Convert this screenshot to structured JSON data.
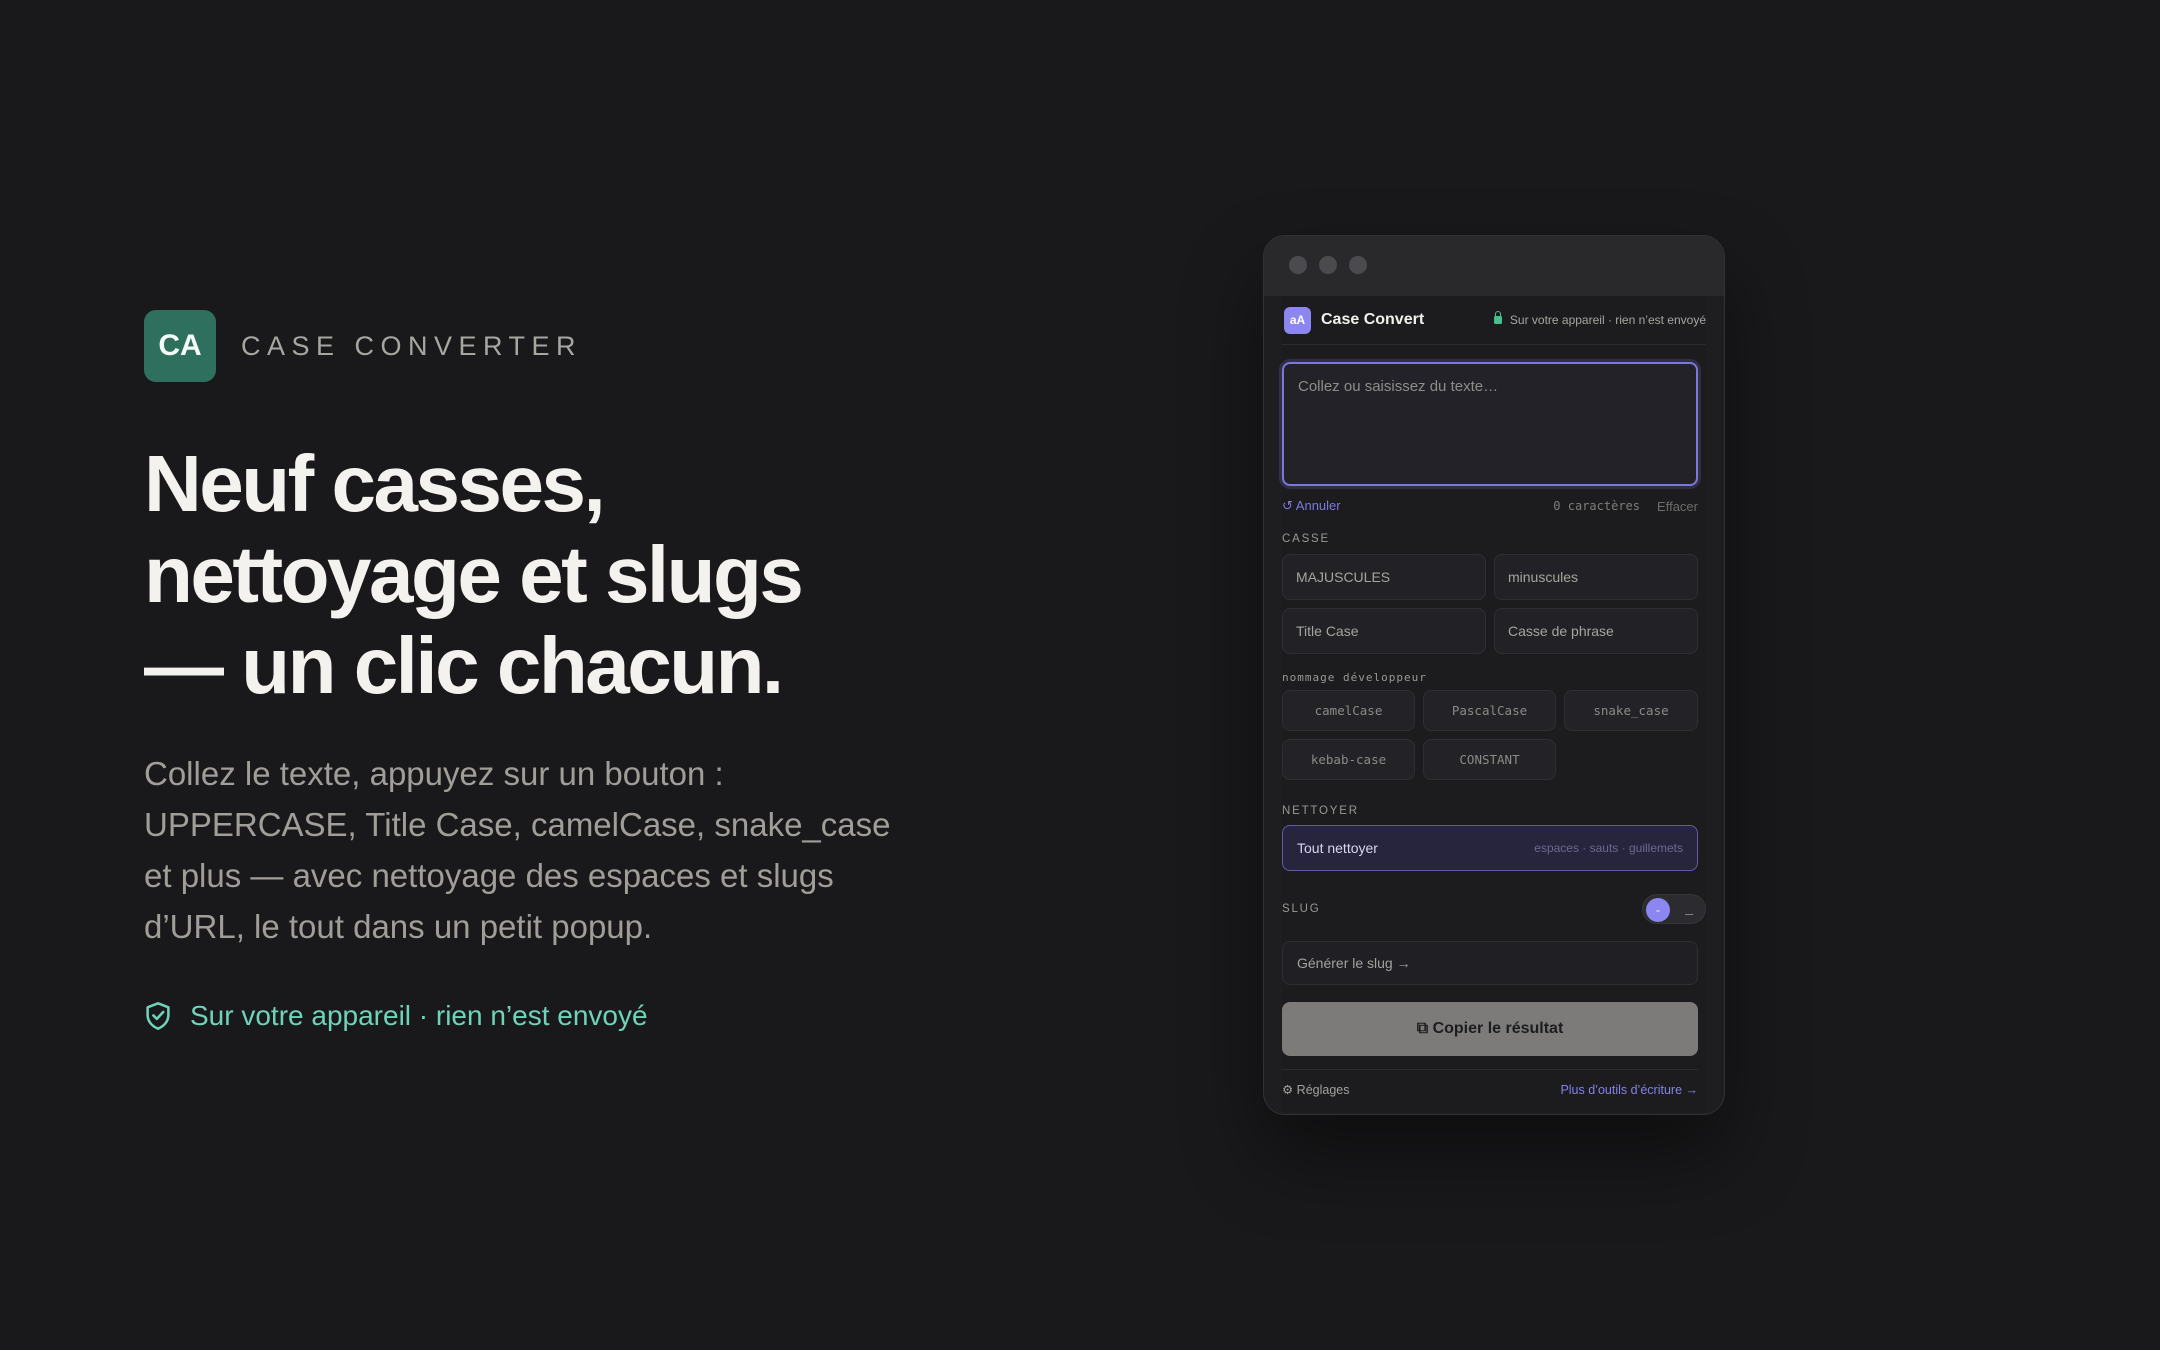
{
  "brand": {
    "badge": "CA",
    "name": "CASE CONVERTER"
  },
  "hero": {
    "headline_line1": "Neuf casses,",
    "headline_line2": "nettoyage et slugs",
    "headline_line3": "— un clic chacun.",
    "lede_line1": "Collez le texte, appuyez sur un bouton :",
    "lede_line2": "UPPERCASE, Title Case, camelCase, snake_case",
    "lede_line3": "et plus — avec nettoyage des espaces et slugs",
    "lede_line4": "d’URL, le tout dans un petit popup.",
    "privacy": "Sur votre appareil · rien n’est envoyé"
  },
  "popup": {
    "logo": "aA",
    "title": "Case Convert",
    "privacy": "Sur votre appareil · rien n’est envoyé",
    "input_placeholder": "Collez ou saisissez du texte…",
    "undo": "↺ Annuler",
    "char_count": "0 caractères",
    "clear": "Effacer",
    "case_label": "CASSE",
    "case_buttons": [
      "MAJUSCULES",
      "minuscules",
      "Title Case",
      "Casse de phrase"
    ],
    "dev_label": "nommage développeur",
    "dev_buttons": [
      "camelCase",
      "PascalCase",
      "snake_case",
      "kebab-case",
      "CONSTANT"
    ],
    "clean_label": "NETTOYER",
    "clean_button": "Tout nettoyer",
    "clean_hint": "espaces · sauts · guillemets",
    "slug_label": "SLUG",
    "slug_toggle_on": "-",
    "slug_toggle_off": "_",
    "slug_button": "Générer le slug →",
    "copy_button": "⧉ Copier le résultat",
    "settings": "⚙ Réglages",
    "more_tools": "Plus d’outils d’écriture →"
  },
  "colors": {
    "background": "#19191b",
    "brand_green": "#2f6f5e",
    "privacy_teal": "#6fd3ba",
    "accent_purple": "#8b86f0"
  }
}
